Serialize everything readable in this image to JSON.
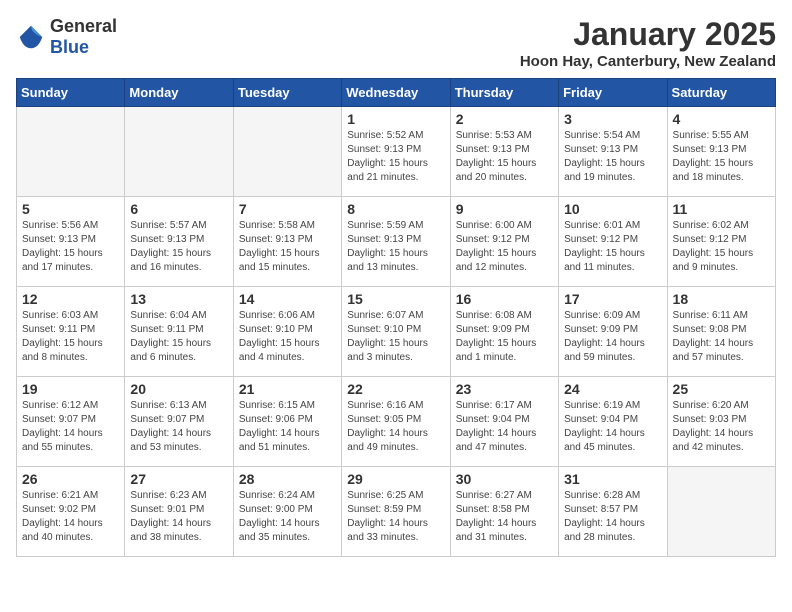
{
  "logo": {
    "general": "General",
    "blue": "Blue"
  },
  "header": {
    "month": "January 2025",
    "location": "Hoon Hay, Canterbury, New Zealand"
  },
  "weekdays": [
    "Sunday",
    "Monday",
    "Tuesday",
    "Wednesday",
    "Thursday",
    "Friday",
    "Saturday"
  ],
  "weeks": [
    [
      {
        "day": "",
        "info": ""
      },
      {
        "day": "",
        "info": ""
      },
      {
        "day": "",
        "info": ""
      },
      {
        "day": "1",
        "info": "Sunrise: 5:52 AM\nSunset: 9:13 PM\nDaylight: 15 hours\nand 21 minutes."
      },
      {
        "day": "2",
        "info": "Sunrise: 5:53 AM\nSunset: 9:13 PM\nDaylight: 15 hours\nand 20 minutes."
      },
      {
        "day": "3",
        "info": "Sunrise: 5:54 AM\nSunset: 9:13 PM\nDaylight: 15 hours\nand 19 minutes."
      },
      {
        "day": "4",
        "info": "Sunrise: 5:55 AM\nSunset: 9:13 PM\nDaylight: 15 hours\nand 18 minutes."
      }
    ],
    [
      {
        "day": "5",
        "info": "Sunrise: 5:56 AM\nSunset: 9:13 PM\nDaylight: 15 hours\nand 17 minutes."
      },
      {
        "day": "6",
        "info": "Sunrise: 5:57 AM\nSunset: 9:13 PM\nDaylight: 15 hours\nand 16 minutes."
      },
      {
        "day": "7",
        "info": "Sunrise: 5:58 AM\nSunset: 9:13 PM\nDaylight: 15 hours\nand 15 minutes."
      },
      {
        "day": "8",
        "info": "Sunrise: 5:59 AM\nSunset: 9:13 PM\nDaylight: 15 hours\nand 13 minutes."
      },
      {
        "day": "9",
        "info": "Sunrise: 6:00 AM\nSunset: 9:12 PM\nDaylight: 15 hours\nand 12 minutes."
      },
      {
        "day": "10",
        "info": "Sunrise: 6:01 AM\nSunset: 9:12 PM\nDaylight: 15 hours\nand 11 minutes."
      },
      {
        "day": "11",
        "info": "Sunrise: 6:02 AM\nSunset: 9:12 PM\nDaylight: 15 hours\nand 9 minutes."
      }
    ],
    [
      {
        "day": "12",
        "info": "Sunrise: 6:03 AM\nSunset: 9:11 PM\nDaylight: 15 hours\nand 8 minutes."
      },
      {
        "day": "13",
        "info": "Sunrise: 6:04 AM\nSunset: 9:11 PM\nDaylight: 15 hours\nand 6 minutes."
      },
      {
        "day": "14",
        "info": "Sunrise: 6:06 AM\nSunset: 9:10 PM\nDaylight: 15 hours\nand 4 minutes."
      },
      {
        "day": "15",
        "info": "Sunrise: 6:07 AM\nSunset: 9:10 PM\nDaylight: 15 hours\nand 3 minutes."
      },
      {
        "day": "16",
        "info": "Sunrise: 6:08 AM\nSunset: 9:09 PM\nDaylight: 15 hours\nand 1 minute."
      },
      {
        "day": "17",
        "info": "Sunrise: 6:09 AM\nSunset: 9:09 PM\nDaylight: 14 hours\nand 59 minutes."
      },
      {
        "day": "18",
        "info": "Sunrise: 6:11 AM\nSunset: 9:08 PM\nDaylight: 14 hours\nand 57 minutes."
      }
    ],
    [
      {
        "day": "19",
        "info": "Sunrise: 6:12 AM\nSunset: 9:07 PM\nDaylight: 14 hours\nand 55 minutes."
      },
      {
        "day": "20",
        "info": "Sunrise: 6:13 AM\nSunset: 9:07 PM\nDaylight: 14 hours\nand 53 minutes."
      },
      {
        "day": "21",
        "info": "Sunrise: 6:15 AM\nSunset: 9:06 PM\nDaylight: 14 hours\nand 51 minutes."
      },
      {
        "day": "22",
        "info": "Sunrise: 6:16 AM\nSunset: 9:05 PM\nDaylight: 14 hours\nand 49 minutes."
      },
      {
        "day": "23",
        "info": "Sunrise: 6:17 AM\nSunset: 9:04 PM\nDaylight: 14 hours\nand 47 minutes."
      },
      {
        "day": "24",
        "info": "Sunrise: 6:19 AM\nSunset: 9:04 PM\nDaylight: 14 hours\nand 45 minutes."
      },
      {
        "day": "25",
        "info": "Sunrise: 6:20 AM\nSunset: 9:03 PM\nDaylight: 14 hours\nand 42 minutes."
      }
    ],
    [
      {
        "day": "26",
        "info": "Sunrise: 6:21 AM\nSunset: 9:02 PM\nDaylight: 14 hours\nand 40 minutes."
      },
      {
        "day": "27",
        "info": "Sunrise: 6:23 AM\nSunset: 9:01 PM\nDaylight: 14 hours\nand 38 minutes."
      },
      {
        "day": "28",
        "info": "Sunrise: 6:24 AM\nSunset: 9:00 PM\nDaylight: 14 hours\nand 35 minutes."
      },
      {
        "day": "29",
        "info": "Sunrise: 6:25 AM\nSunset: 8:59 PM\nDaylight: 14 hours\nand 33 minutes."
      },
      {
        "day": "30",
        "info": "Sunrise: 6:27 AM\nSunset: 8:58 PM\nDaylight: 14 hours\nand 31 minutes."
      },
      {
        "day": "31",
        "info": "Sunrise: 6:28 AM\nSunset: 8:57 PM\nDaylight: 14 hours\nand 28 minutes."
      },
      {
        "day": "",
        "info": ""
      }
    ]
  ]
}
